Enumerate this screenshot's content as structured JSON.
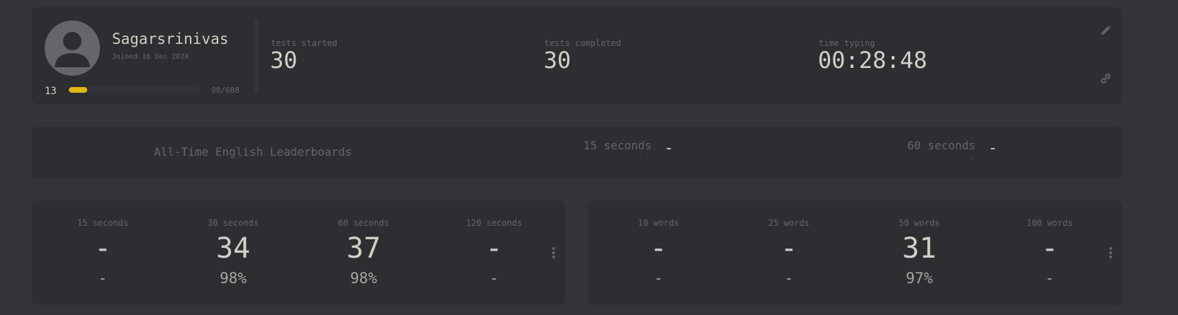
{
  "profile": {
    "username": "Sagarsrinivas",
    "joined": "Joined 18 Dec 2024",
    "level": "13",
    "xp_text": "98/688",
    "xp_progress": 0.142,
    "avatar_icon": "user-avatar-icon"
  },
  "stats": {
    "tests_started_label": "tests started",
    "tests_started_value": "30",
    "tests_completed_label": "tests completed",
    "tests_completed_value": "30",
    "time_typing_label": "time typing",
    "time_typing_value": "00:28:48"
  },
  "actions": {
    "edit_icon": "pencil-icon",
    "link_icon": "link-icon"
  },
  "leaderboards": {
    "title": "All-Time English Leaderboards",
    "items": [
      {
        "label": "15 seconds",
        "sub": "-",
        "rank": "-"
      },
      {
        "label": "60 seconds",
        "sub": "-",
        "rank": "-"
      }
    ]
  },
  "pb_time": [
    {
      "mode": "15 seconds",
      "wpm": "-",
      "acc": "-"
    },
    {
      "mode": "30 seconds",
      "wpm": "34",
      "acc": "98%"
    },
    {
      "mode": "60 seconds",
      "wpm": "37",
      "acc": "98%"
    },
    {
      "mode": "120 seconds",
      "wpm": "-",
      "acc": "-"
    }
  ],
  "pb_words": [
    {
      "mode": "10 words",
      "wpm": "-",
      "acc": "-"
    },
    {
      "mode": "25 words",
      "wpm": "-",
      "acc": "-"
    },
    {
      "mode": "50 words",
      "wpm": "31",
      "acc": "97%"
    },
    {
      "mode": "100 words",
      "wpm": "-",
      "acc": "-"
    }
  ],
  "colors": {
    "background": "#323437",
    "card": "#2c2e31",
    "accent": "#e2b714",
    "text": "#d1d0c5",
    "sub_text": "#646669"
  }
}
